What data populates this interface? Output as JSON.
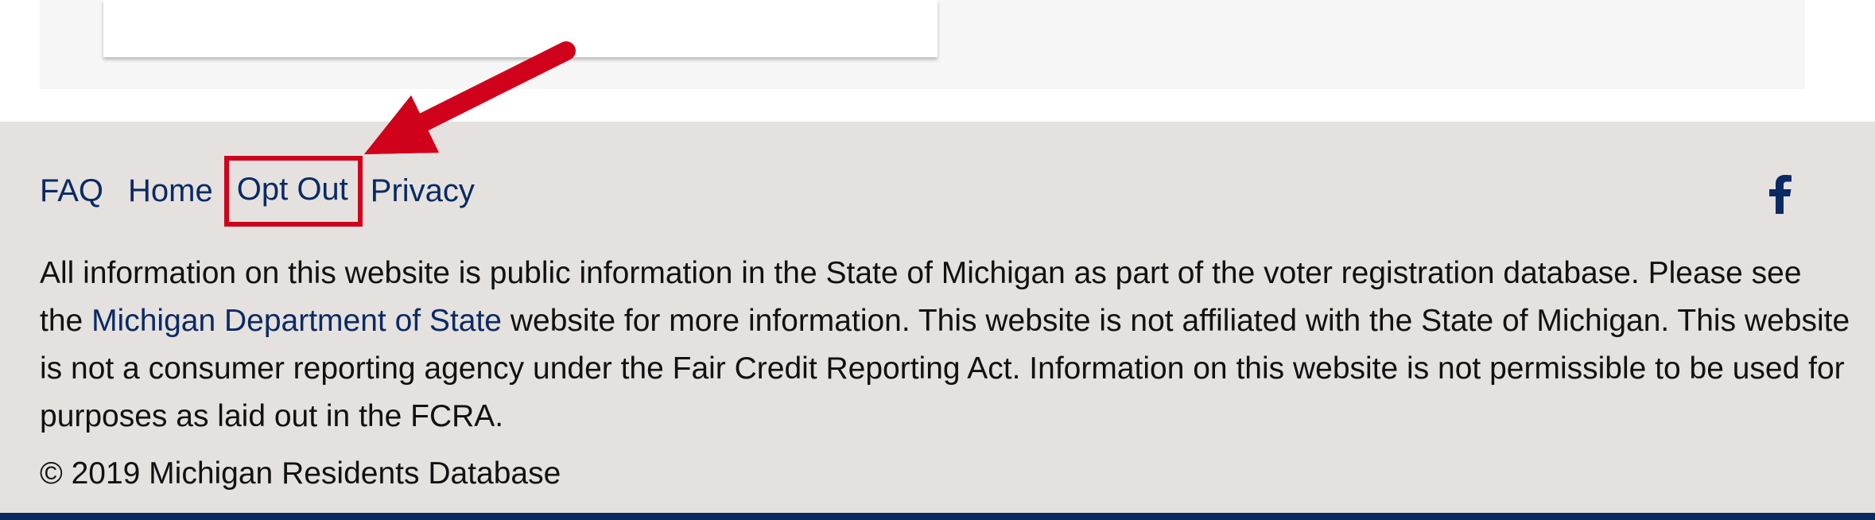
{
  "footer": {
    "nav": [
      {
        "label": "FAQ"
      },
      {
        "label": "Home"
      },
      {
        "label": "Opt Out"
      },
      {
        "label": "Privacy"
      }
    ],
    "social": {
      "icon": "facebook-icon"
    },
    "disclaimer": {
      "part1": "All information on this website is public information in the State of Michigan as part of the voter registration database. Please see the ",
      "link": "Michigan Department of State",
      "part2": " website for more information. This website is not affiliated with the State of Michigan. This website is not a consumer reporting agency under the Fair Credit Reporting Act. Information on this website is not permissible to be used for purposes as laid out in the FCRA."
    },
    "copyright": "© 2019 Michigan Residents Database"
  },
  "annotation": {
    "highlight_color": "#d0021b",
    "highlighted_item": "Opt Out"
  },
  "colors": {
    "footer_bg": "#e4e1df",
    "link": "#0b2a63",
    "bottom_bar": "#0b2a63"
  }
}
